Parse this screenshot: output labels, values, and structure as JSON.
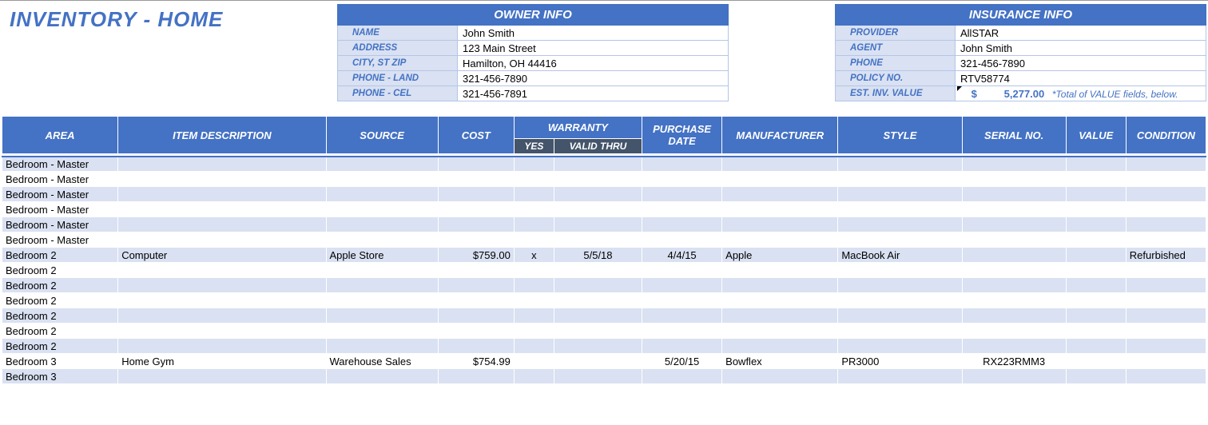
{
  "title": "INVENTORY - HOME",
  "owner": {
    "header": "OWNER INFO",
    "rows": [
      {
        "label": "Name",
        "value": "John Smith"
      },
      {
        "label": "Address",
        "value": "123 Main Street"
      },
      {
        "label": "City, St  Zip",
        "value": "Hamilton, OH  44416"
      },
      {
        "label": "Phone - Land",
        "value": "321-456-7890"
      },
      {
        "label": "Phone - Cel",
        "value": "321-456-7891"
      }
    ]
  },
  "insurance": {
    "header": "INSURANCE INFO",
    "rows": [
      {
        "label": "Provider",
        "value": "AllSTAR"
      },
      {
        "label": "Agent",
        "value": "John Smith"
      },
      {
        "label": "Phone",
        "value": "321-456-7890"
      },
      {
        "label": "Policy No.",
        "value": "RTV58774"
      }
    ],
    "est_label": "Est. Inv. Value",
    "est_currency": "$",
    "est_value": "5,277.00",
    "est_note": "*Total of VALUE fields, below."
  },
  "columns": {
    "area": "AREA",
    "item": "ITEM DESCRIPTION",
    "source": "SOURCE",
    "cost": "COST",
    "warranty": "WARRANTY",
    "wyes": "YES",
    "wthru": "VALID THRU",
    "pdate": "PURCHASE DATE",
    "mfr": "MANUFACTURER",
    "style": "STYLE",
    "serial": "SERIAL NO.",
    "value": "VALUE",
    "cond": "CONDITION"
  },
  "rows": [
    {
      "area": "Bedroom - Master"
    },
    {
      "area": "Bedroom - Master"
    },
    {
      "area": "Bedroom - Master"
    },
    {
      "area": "Bedroom - Master"
    },
    {
      "area": "Bedroom - Master"
    },
    {
      "area": "Bedroom - Master"
    },
    {
      "area": "Bedroom 2",
      "item": "Computer",
      "source": "Apple Store",
      "cost": "$759.00",
      "wyes": "x",
      "wthru": "5/5/18",
      "pdate": "4/4/15",
      "mfr": "Apple",
      "style": "MacBook Air",
      "serial": "",
      "value": "",
      "cond": "Refurbished"
    },
    {
      "area": "Bedroom 2"
    },
    {
      "area": "Bedroom 2"
    },
    {
      "area": "Bedroom 2"
    },
    {
      "area": "Bedroom 2"
    },
    {
      "area": "Bedroom 2"
    },
    {
      "area": "Bedroom 2"
    },
    {
      "area": "Bedroom 3",
      "item": "Home Gym",
      "source": "Warehouse Sales",
      "cost": "$754.99",
      "wyes": "",
      "wthru": "",
      "pdate": "5/20/15",
      "mfr": "Bowflex",
      "style": "PR3000",
      "serial": "RX223RMM3",
      "value": "",
      "cond": ""
    },
    {
      "area": "Bedroom 3"
    }
  ]
}
